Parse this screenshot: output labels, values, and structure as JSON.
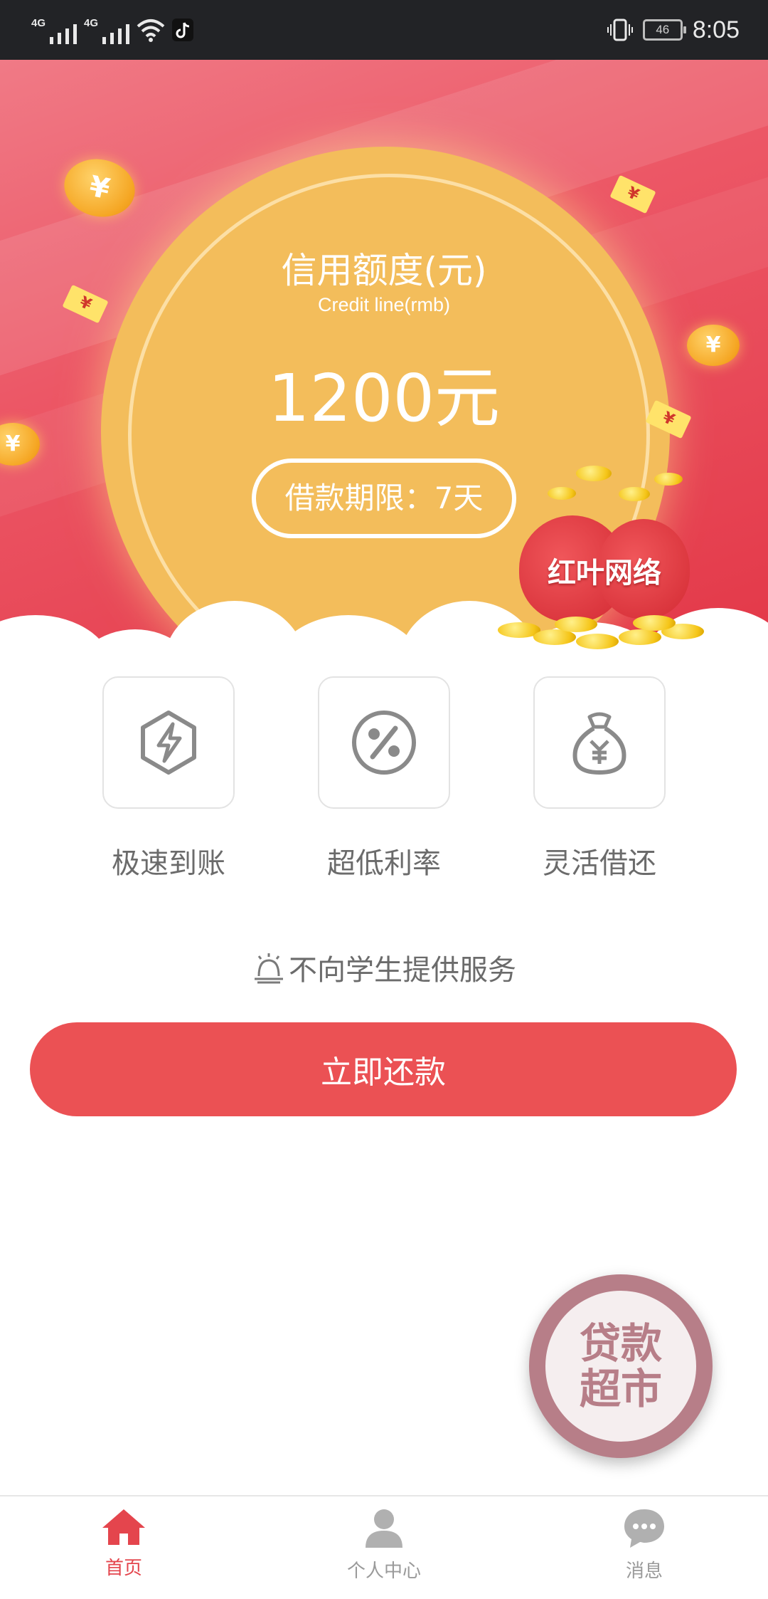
{
  "status_bar": {
    "network1": "4G",
    "network2": "4G",
    "battery": "46",
    "time": "8:05",
    "icons": [
      "signal-icon",
      "signal-icon",
      "wifi-icon",
      "tiktok-icon",
      "vibrate-icon",
      "battery-icon"
    ]
  },
  "hero": {
    "credit_title": "信用额度(元)",
    "credit_subtitle": "Credit line(rmb)",
    "credit_amount": "1200元",
    "loan_term": "借款期限：7天",
    "bag_label": "红叶网络",
    "coin_symbol": "¥",
    "colors": {
      "background": "#ec5766",
      "circle": "#f3bd5b"
    }
  },
  "features": [
    {
      "label": "极速到账",
      "icon": "lightning-hexagon-icon"
    },
    {
      "label": "超低利率",
      "icon": "percent-circle-icon"
    },
    {
      "label": "灵活借还",
      "icon": "money-bag-icon"
    }
  ],
  "notice": {
    "text": "不向学生提供服务",
    "icon": "alarm-bell-icon"
  },
  "primary_button": {
    "label": "立即还款",
    "color": "#eb5154"
  },
  "floating_button": {
    "line1": "贷款",
    "line2": "超市"
  },
  "tabs": [
    {
      "label": "首页",
      "icon": "home-icon",
      "active": true
    },
    {
      "label": "个人中心",
      "icon": "person-icon",
      "active": false
    },
    {
      "label": "消息",
      "icon": "chat-bubble-icon",
      "active": false
    }
  ],
  "accent_color": "#e4454d"
}
